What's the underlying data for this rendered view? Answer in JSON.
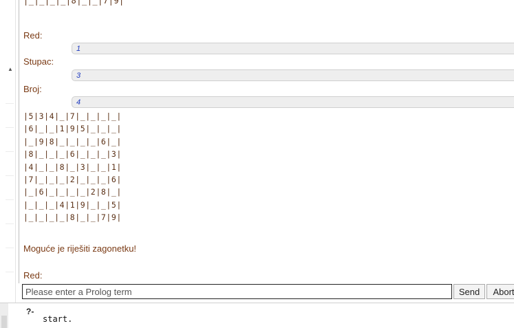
{
  "output": {
    "board_top_partial": "|_|_|_|_|8|_|_|7|9|",
    "prompts": [
      {
        "label": "Red:",
        "answer": "1"
      },
      {
        "label": "Stupac:",
        "answer": "3"
      },
      {
        "label": "Broj:",
        "answer": "4"
      }
    ],
    "board_rows": [
      "|5|3|4|_|7|_|_|_|_|",
      "|6|_|_|1|9|5|_|_|_|",
      "|_|9|8|_|_|_|_|6|_|",
      "|8|_|_|_|6|_|_|_|3|",
      "|4|_|_|8|_|3|_|_|1|",
      "|7|_|_|_|2|_|_|_|6|",
      "|_|6|_|_|_|_|2|8|_|",
      "|_|_|_|4|1|9|_|_|5|",
      "|_|_|_|_|8|_|_|7|9|"
    ],
    "result_text": "Moguće je riješiti zagonetku!",
    "next_prompt": "Red:"
  },
  "input": {
    "placeholder": "Please enter a Prolog term",
    "send_label": "Send",
    "abort_label": "Abort"
  },
  "editor": {
    "prompt": "?-",
    "query": "start."
  }
}
